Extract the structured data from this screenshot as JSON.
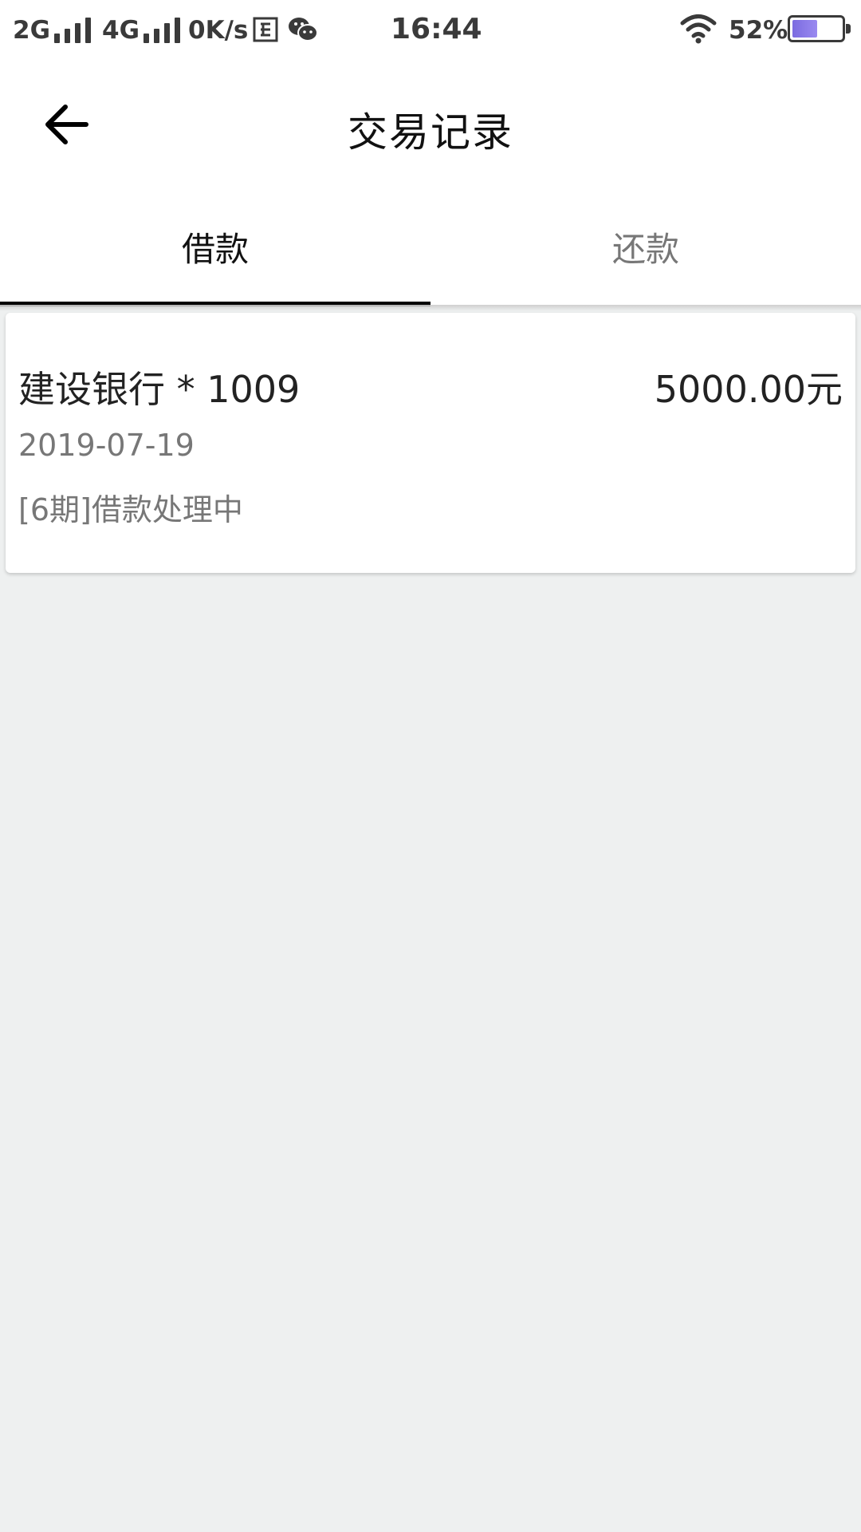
{
  "status_bar": {
    "network1": "2G",
    "network2": "4G",
    "speed": "0K/s",
    "time": "16:44",
    "battery": "52%",
    "battery_level": 0.52
  },
  "header": {
    "title": "交易记录"
  },
  "tabs": [
    {
      "label": "借款",
      "active": true
    },
    {
      "label": "还款",
      "active": false
    }
  ],
  "records": [
    {
      "bank": "建设银行 * 1009",
      "amount": "5000.00元",
      "date": "2019-07-19",
      "status": "[6期]借款处理中"
    }
  ],
  "colors": {
    "background": "#eef0f0",
    "indicator": "#000000",
    "secondary_text": "#777777"
  }
}
